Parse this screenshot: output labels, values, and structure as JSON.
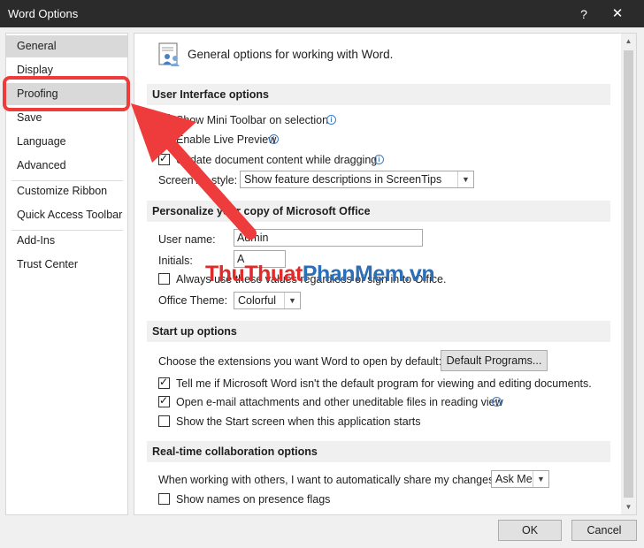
{
  "window": {
    "title": "Word Options",
    "help_label": "?",
    "close_label": "✕"
  },
  "nav": {
    "items": [
      {
        "label": "General"
      },
      {
        "label": "Display"
      },
      {
        "label": "Proofing"
      },
      {
        "label": "Save"
      },
      {
        "label": "Language"
      },
      {
        "label": "Advanced"
      },
      {
        "label": "Customize Ribbon"
      },
      {
        "label": "Quick Access Toolbar"
      },
      {
        "label": "Add-Ins"
      },
      {
        "label": "Trust Center"
      }
    ]
  },
  "content": {
    "header": "General options for working with Word.",
    "ui_section": {
      "title": "User Interface options",
      "mini_toolbar": {
        "label": "Show Mini Toolbar on selection",
        "checked": true
      },
      "live_preview": {
        "label": "Enable Live Preview",
        "checked": true
      },
      "update_content": {
        "label": "Update document content while dragging",
        "checked": true
      },
      "screentip_label": "ScreenTip style:",
      "screentip_value": "Show feature descriptions in ScreenTips"
    },
    "personalize_section": {
      "title": "Personalize your copy of Microsoft Office",
      "username_label": "User name:",
      "username_value": "Admin",
      "initials_label": "Initials:",
      "initials_value": "A",
      "always_use_label": "Always use these values regardless of sign in to Office.",
      "always_use_checked": false,
      "theme_label": "Office Theme:",
      "theme_value": "Colorful"
    },
    "startup_section": {
      "title": "Start up options",
      "extensions_label": "Choose the extensions you want Word to open by default:",
      "default_programs_button": "Default Programs...",
      "tell_me": {
        "label": "Tell me if Microsoft Word isn't the default program for viewing and editing documents.",
        "checked": true
      },
      "open_email": {
        "label": "Open e-mail attachments and other uneditable files in reading view",
        "checked": true
      },
      "start_screen": {
        "label": "Show the Start screen when this application starts",
        "checked": false
      }
    },
    "collab_section": {
      "title": "Real-time collaboration options",
      "share_label": "When working with others, I want to automatically share my changes:",
      "share_value": "Ask Me",
      "presence": {
        "label": "Show names on presence flags",
        "checked": false
      }
    }
  },
  "footer": {
    "ok_label": "OK",
    "cancel_label": "Cancel"
  },
  "watermark": {
    "part1": "Thu",
    "part2": "Thuat",
    "part3": "Phan",
    "part4": "Mem",
    "part5": ".vn"
  },
  "icons": {
    "info": "info-icon",
    "dropdown": "chevron-down-icon",
    "options": "options-people-icon"
  },
  "colors": {
    "annotation": "#ee3b3b",
    "title_bar": "#2b2b2b",
    "nav_selected": "#d9d9d9",
    "section_bg": "#f0f0f0"
  }
}
